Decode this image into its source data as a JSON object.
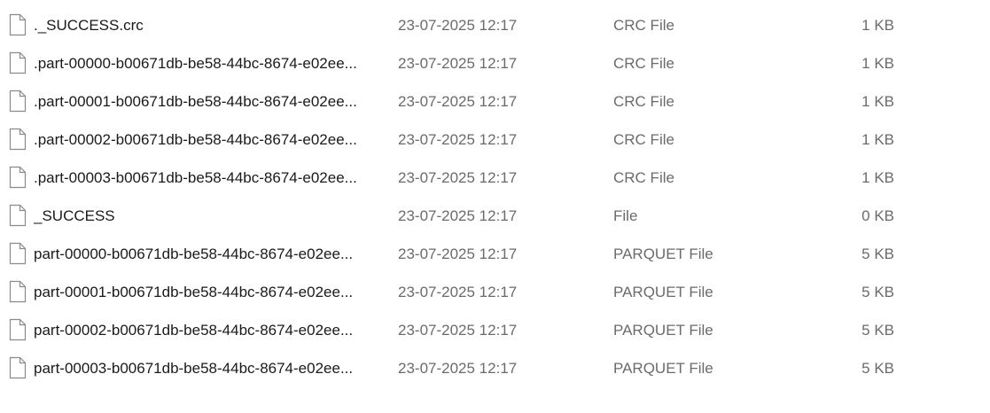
{
  "files": [
    {
      "name": "._SUCCESS.crc",
      "modified": "23-07-2025 12:17",
      "type": "CRC File",
      "size": "1 KB",
      "icon": "generic-file-icon"
    },
    {
      "name": ".part-00000-b00671db-be58-44bc-8674-e02ee...",
      "modified": "23-07-2025 12:17",
      "type": "CRC File",
      "size": "1 KB",
      "icon": "generic-file-icon"
    },
    {
      "name": ".part-00001-b00671db-be58-44bc-8674-e02ee...",
      "modified": "23-07-2025 12:17",
      "type": "CRC File",
      "size": "1 KB",
      "icon": "generic-file-icon"
    },
    {
      "name": ".part-00002-b00671db-be58-44bc-8674-e02ee...",
      "modified": "23-07-2025 12:17",
      "type": "CRC File",
      "size": "1 KB",
      "icon": "generic-file-icon"
    },
    {
      "name": ".part-00003-b00671db-be58-44bc-8674-e02ee...",
      "modified": "23-07-2025 12:17",
      "type": "CRC File",
      "size": "1 KB",
      "icon": "generic-file-icon"
    },
    {
      "name": "_SUCCESS",
      "modified": "23-07-2025 12:17",
      "type": "File",
      "size": "0 KB",
      "icon": "generic-file-icon"
    },
    {
      "name": "part-00000-b00671db-be58-44bc-8674-e02ee...",
      "modified": "23-07-2025 12:17",
      "type": "PARQUET File",
      "size": "5 KB",
      "icon": "generic-file-icon"
    },
    {
      "name": "part-00001-b00671db-be58-44bc-8674-e02ee...",
      "modified": "23-07-2025 12:17",
      "type": "PARQUET File",
      "size": "5 KB",
      "icon": "generic-file-icon"
    },
    {
      "name": "part-00002-b00671db-be58-44bc-8674-e02ee...",
      "modified": "23-07-2025 12:17",
      "type": "PARQUET File",
      "size": "5 KB",
      "icon": "generic-file-icon"
    },
    {
      "name": "part-00003-b00671db-be58-44bc-8674-e02ee...",
      "modified": "23-07-2025 12:17",
      "type": "PARQUET File",
      "size": "5 KB",
      "icon": "generic-file-icon"
    }
  ],
  "colors": {
    "text_primary": "#1a1a1a",
    "text_secondary": "#6b6b6b",
    "icon_stroke": "#8a8a8a",
    "background": "#ffffff"
  }
}
